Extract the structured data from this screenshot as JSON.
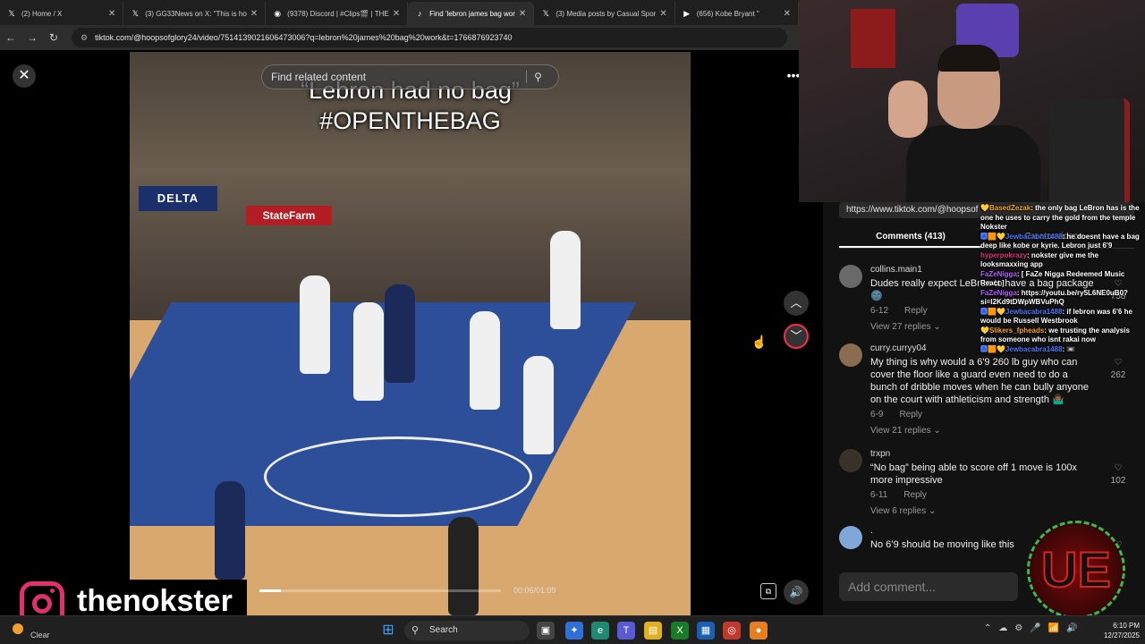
{
  "browser": {
    "tabs": [
      {
        "icon": "x-icon",
        "glyph": "𝕏",
        "title": "(2) Home / X",
        "active": false
      },
      {
        "icon": "x-icon",
        "glyph": "𝕏",
        "title": "(3) GG33News on X: \"This is ho",
        "active": false
      },
      {
        "icon": "discord-icon",
        "glyph": "◉",
        "title": "(9378) Discord | #Clips🎬 | THE",
        "active": false
      },
      {
        "icon": "tiktok-icon",
        "glyph": "♪",
        "title": "Find 'lebron james bag wor",
        "active": true
      },
      {
        "icon": "x-icon",
        "glyph": "𝕏",
        "title": "(3) Media posts by Casual Spor",
        "active": false
      },
      {
        "icon": "youtube-icon",
        "glyph": "▶",
        "title": "(656) Kobe Bryant \"",
        "active": false
      }
    ],
    "url": "tiktok.com/@hoopsofglory24/video/7514139021606473006?q=lebron%20james%20bag%20work&t=1766876923740"
  },
  "video": {
    "search_placeholder": "Find related content",
    "caption_line1": "“Lebron had no bag”",
    "caption_line2": "#OPENTHEBAG",
    "delta_sign": "DELTA",
    "statefarm_sign": "StateFarm",
    "timecode": "00:06/01:09",
    "progress": 0.09
  },
  "panel": {
    "copy_link": "https://www.tiktok.com/@hoopsof",
    "tab_comments": "Comments (413)",
    "tab_creator": "Creator videos",
    "comments": [
      {
        "user": "collins.main1",
        "text": "Dudes really expect LeBron to have a bag package 🌚",
        "date": "6-12",
        "reply": "Reply",
        "replies": "View 27 replies ⌄",
        "likes": "758",
        "avatar_color": "#6a6a6a"
      },
      {
        "user": "curry.curryy04",
        "text": "My thing is why would a 6'9 260 lb guy who can cover the floor like a guard even need to do a bunch of dribble moves when he can bully anyone on the court with athleticism and strength 🤷🏾‍♂️",
        "date": "6-9",
        "reply": "Reply",
        "replies": "View 21 replies ⌄",
        "likes": "262",
        "avatar_color": "#8a6c50"
      },
      {
        "user": "trxpn",
        "text": "“No bag” being able to score off 1 move is 100x more impressive",
        "date": "6-11",
        "reply": "Reply",
        "replies": "View 6 replies ⌄",
        "likes": "102",
        "avatar_color": "#3a3228"
      },
      {
        "user": ".",
        "text": "No 6’9 should be moving like this",
        "date": "",
        "reply": "",
        "replies": "",
        "likes": "",
        "avatar_color": "#7fa8d8"
      }
    ],
    "add_comment": "Add comment..."
  },
  "chat": [
    {
      "user": "💛BasedZezak",
      "user_color": "#f5a623",
      "text": ": the only bag LeBron has is the one he uses to carry the gold from the temple Nokster"
    },
    {
      "user": "🅰🟧💛Jewbacabra1488",
      "user_color": "#4a78ff",
      "text": ": he doesnt have a bag deep like kobe or kyrie. Lebron just 6'9"
    },
    {
      "user": "hyperpokrazy",
      "user_color": "#e0337a",
      "text": ": nokster give me the looksmaxxing app"
    },
    {
      "user": "FaZeNigga",
      "user_color": "#b25cff",
      "text": ": [ FaZe Nigga Redeemed Music React ]"
    },
    {
      "user": "FaZeNigga",
      "user_color": "#b25cff",
      "text": ": https://youtu.be/ry5L6NE0uB0?si=I2Kd9tDWpWBVuPhQ"
    },
    {
      "user": "🅰🟧💛Jewbacabra1488",
      "user_color": "#4a78ff",
      "text": ": if lebron was 6'6 he would be Russell Westbrook"
    },
    {
      "user": "💛Slikers_fpheads",
      "user_color": "#f5a623",
      "text": ": we trusting the analysis from someone who isnt rakai now"
    },
    {
      "user": "🅰🟧💛Jewbacabra1488",
      "user_color": "#4a78ff",
      "text": ": 📼"
    }
  ],
  "overlay": {
    "instagram_handle": "thenokster",
    "ue_logo": "UE"
  },
  "taskbar": {
    "weather": "Clear",
    "search": "Search",
    "time": "6:10 PM",
    "date": "12/27/2025"
  },
  "colors": {
    "tiktok_accent": "#fe2c55",
    "instagram": "#e1306c",
    "panel_bg": "#121212"
  }
}
